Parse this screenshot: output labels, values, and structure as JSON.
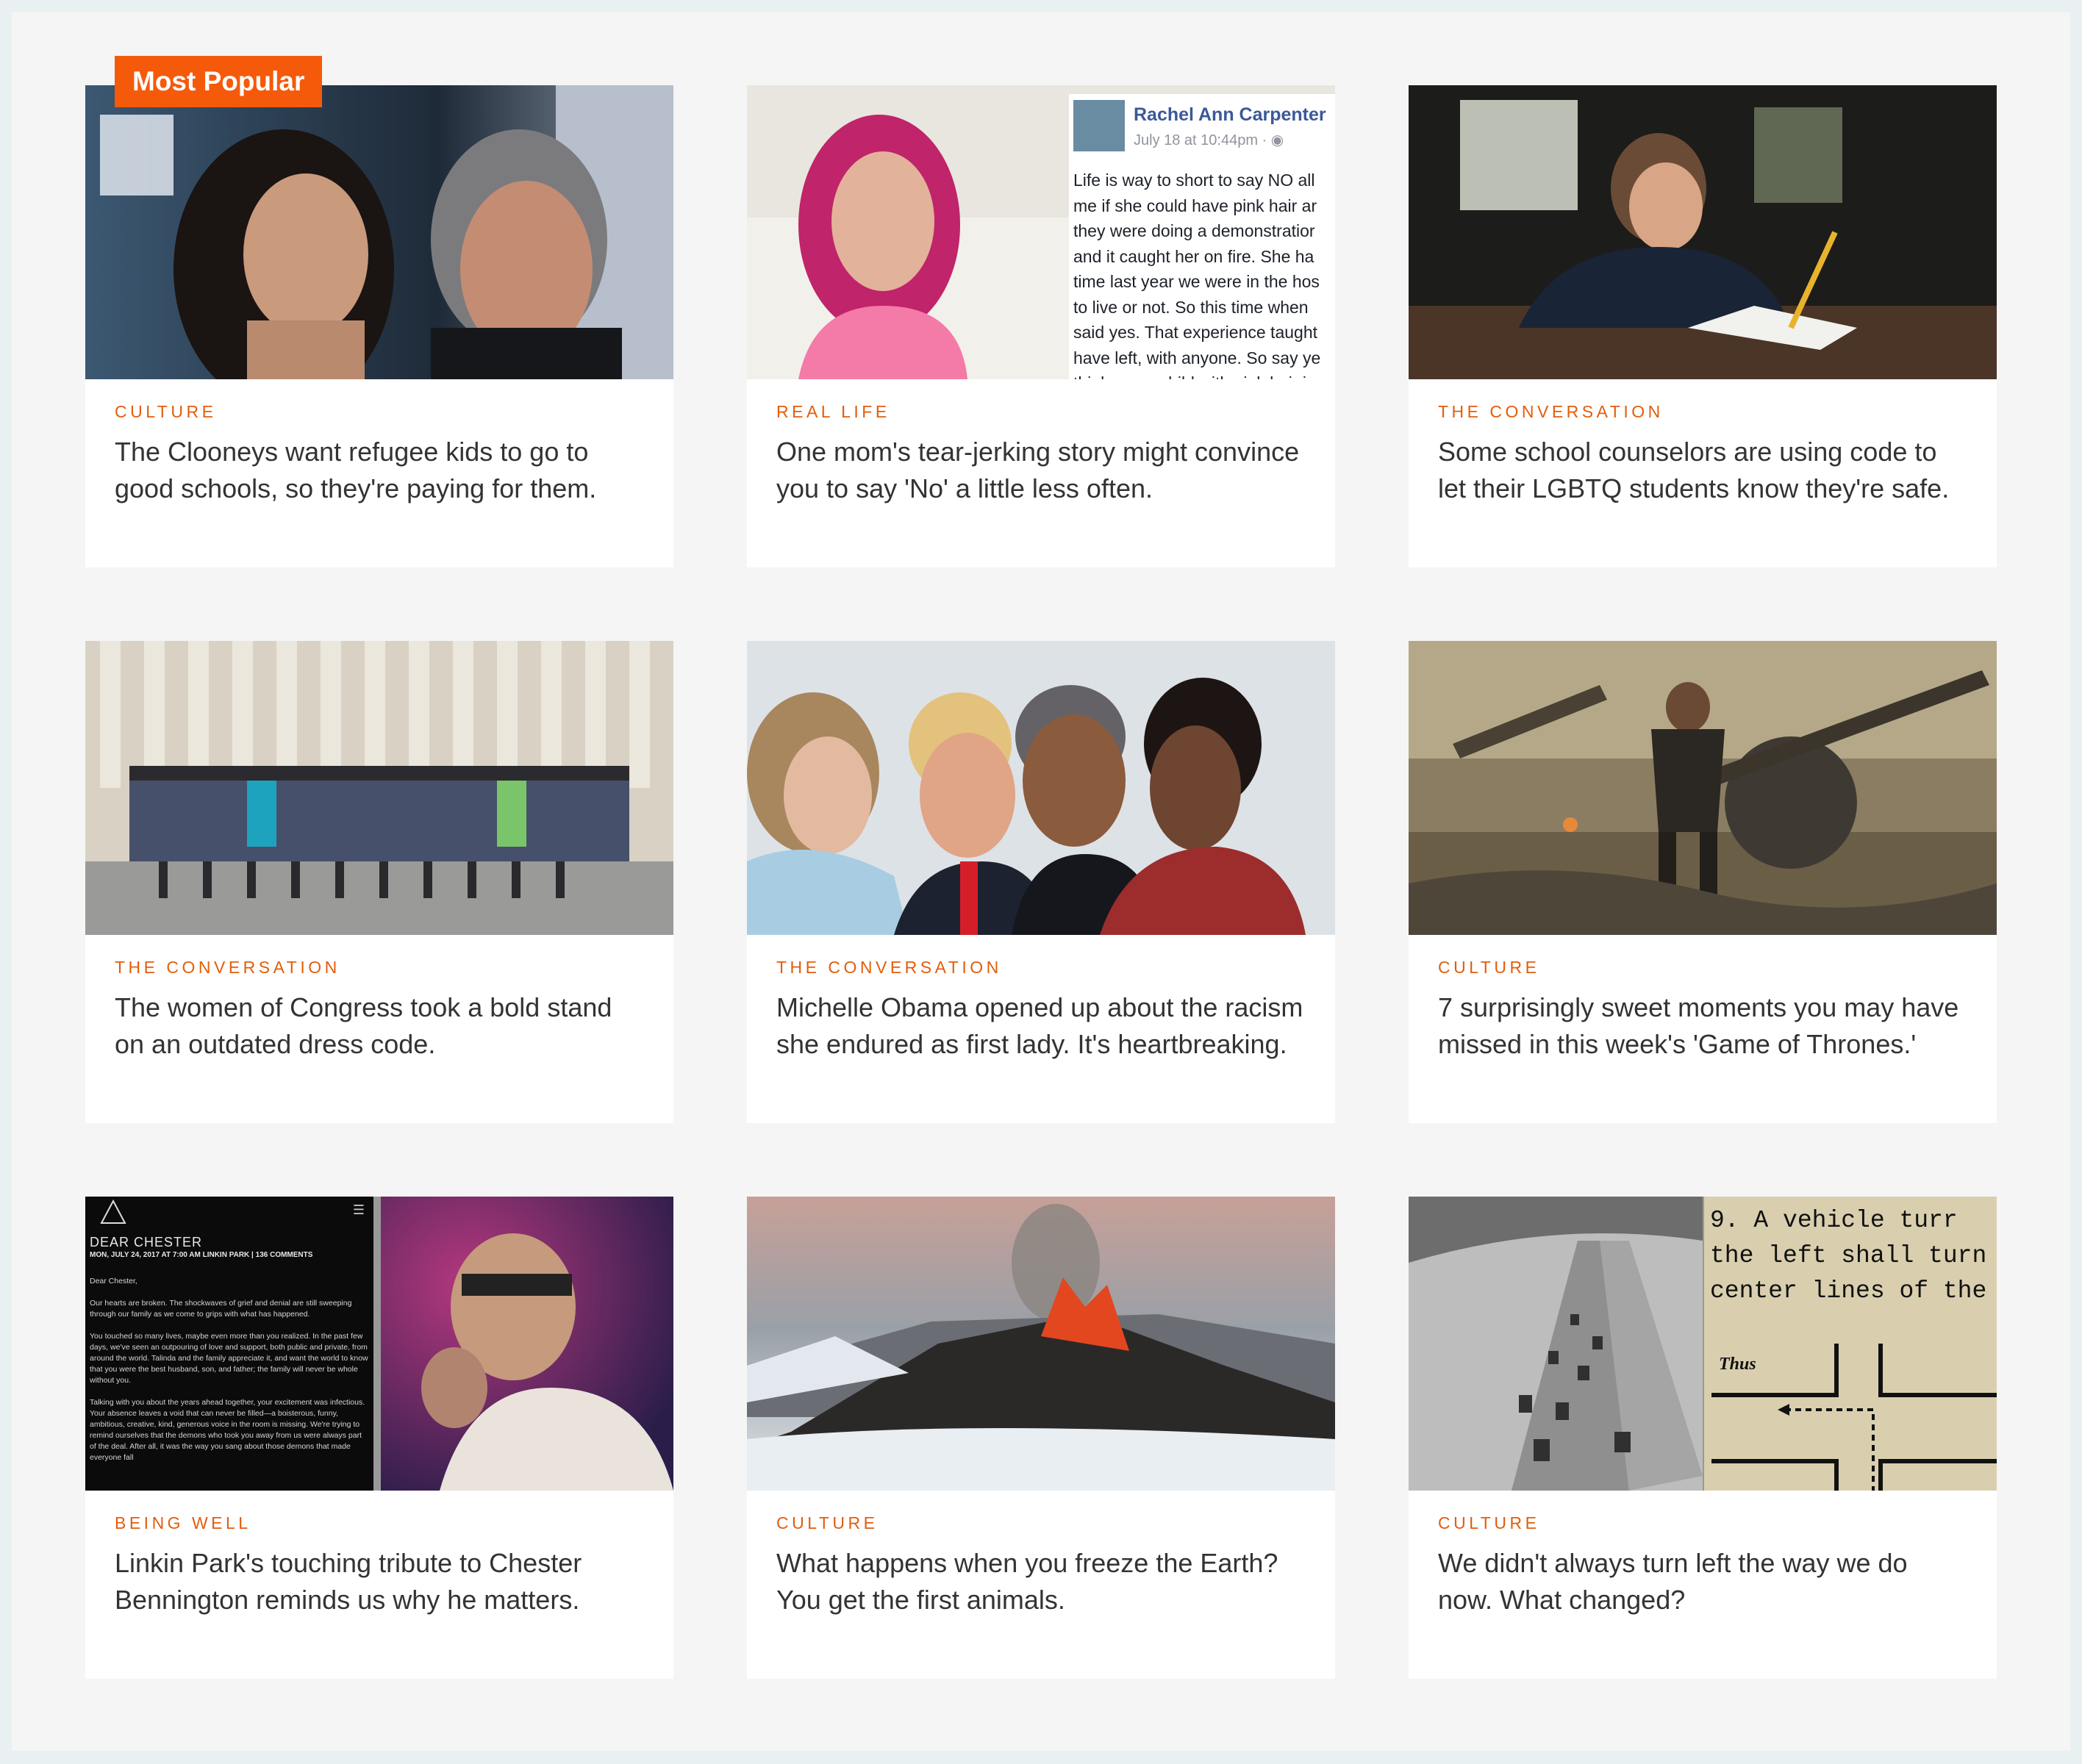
{
  "badge": "Most Popular",
  "colors": {
    "accent": "#e35d0c",
    "badge": "#f55a0a",
    "headline": "#333333"
  },
  "cards": [
    {
      "category": "CULTURE",
      "headline": "The Clooneys want refugee kids to go to good schools, so they're paying for them."
    },
    {
      "category": "REAL LIFE",
      "headline": "One mom's tear-jerking story might convince you to say 'No' a little less often.",
      "fb": {
        "name": "Rachel Ann Carpenter",
        "meta": "July 18 at 10:44pm · ",
        "post": "Life is way to short to say NO all\nme if she could have pink hair ar\nthey were doing a demonstratior\nand it caught her on fire. She ha\ntime last year we were in the hos\nto live or not. So this time when\nsaid yes. That experience taught\nhave left, with anyone. So say ye\nthinks your child with pink hair is"
      }
    },
    {
      "category": "THE CONVERSATION",
      "headline": "Some school counselors are using code to let their LGBTQ students know they're safe."
    },
    {
      "category": "THE CONVERSATION",
      "headline": "The women of Congress took a bold stand on an outdated dress code."
    },
    {
      "category": "THE CONVERSATION",
      "headline": "Michelle Obama opened up about the racism she endured as first lady. It's heartbreaking."
    },
    {
      "category": "CULTURE",
      "headline": "7 surprisingly sweet moments you may have missed in this week's 'Game of Thrones.'"
    },
    {
      "category": "BEING WELL",
      "headline": "Linkin Park's touching tribute to Chester Bennington reminds us why he matters.",
      "letter": {
        "title": "DEAR CHESTER",
        "meta": "MON, JULY 24, 2017 AT 7:00 AM LINKIN PARK | 136 COMMENTS",
        "body": "Dear Chester,\n\nOur hearts are broken. The shockwaves of grief and denial are still sweeping through our family as we come to grips with what has happened.\n\nYou touched so many lives, maybe even more than you realized. In the past few days, we've seen an outpouring of love and support, both public and private, from around the world. Talinda and the family appreciate it, and want the world to know that you were the best husband, son, and father; the family will never be whole without you.\n\nTalking with you about the years ahead together, your excitement was infectious. Your absence leaves a void that can never be filled—a boisterous, funny, ambitious, creative, kind, generous voice in the room is missing. We're trying to remind ourselves that the demons who took you away from us were always part of the deal. After all, it was the way you sang about those demons that made everyone fall"
      }
    },
    {
      "category": "CULTURE",
      "headline": "What happens when you freeze the Earth? You get the first animals."
    },
    {
      "category": "CULTURE",
      "headline": "We didn't always turn left the way we do now. What changed?",
      "manual": {
        "line1": "9.  A vehicle turr",
        "line2": "the left shall turn ar",
        "line3": "center lines of the t",
        "thus": "Thus"
      }
    }
  ]
}
